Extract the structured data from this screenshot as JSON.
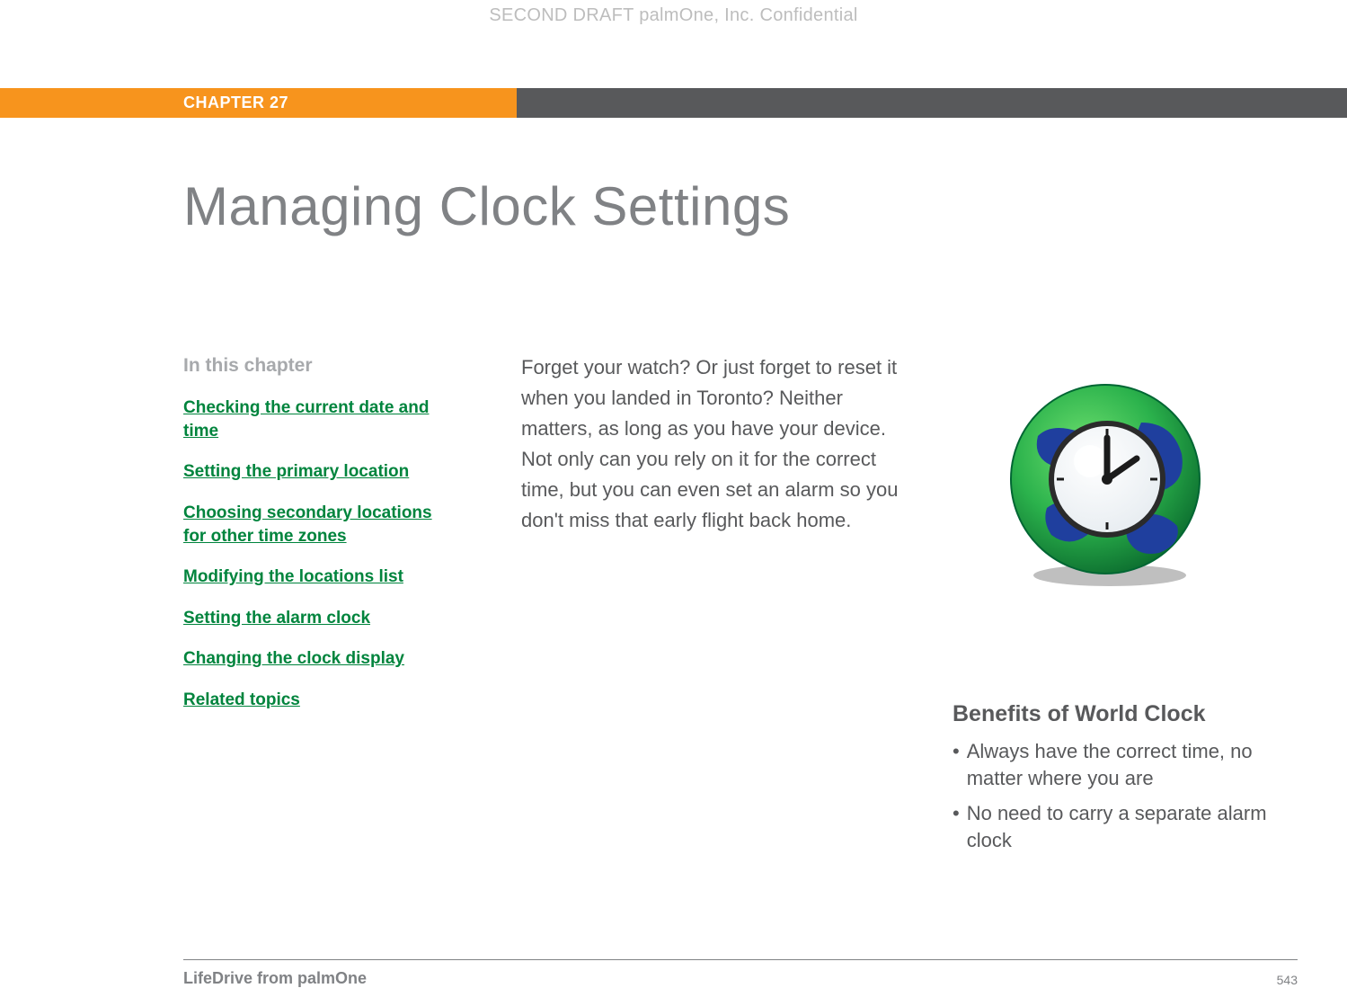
{
  "watermark": "SECOND DRAFT palmOne, Inc.  Confidential",
  "chapter_label": "CHAPTER 27",
  "title": "Managing Clock Settings",
  "sidebar": {
    "heading": "In this chapter",
    "links": [
      "Checking the current date and time",
      "Setting the primary location",
      "Choosing secondary locations for other time zones",
      "Modifying the locations list",
      "Setting the alarm clock",
      "Changing the clock display",
      "Related topics"
    ]
  },
  "intro_text": "Forget your watch? Or just forget to reset it when you landed in Toronto? Neither matters, as long as you have your device. Not only can you rely on it for the correct time, but you can even set an alarm so you don't miss that early flight back home.",
  "benefits": {
    "title": "Benefits of World Clock",
    "items": [
      "Always have the correct time, no matter where you are",
      "No need to carry a separate alarm clock"
    ]
  },
  "footer": {
    "left": "LifeDrive from palmOne",
    "page_number": "543"
  }
}
